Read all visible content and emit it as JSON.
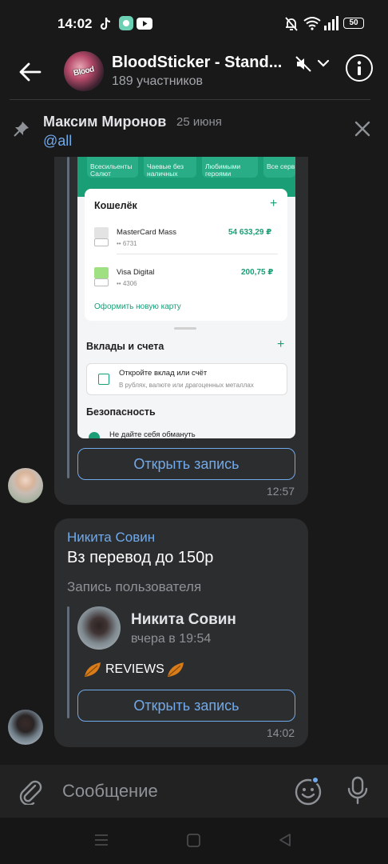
{
  "status_bar": {
    "time": "14:02",
    "battery": "50"
  },
  "header": {
    "avatar_text": "Blood",
    "title": "BloodSticker - Stand...",
    "subtitle": "189 участников"
  },
  "pinned": {
    "author": "Максим Миронов",
    "date": "25 июня",
    "text": "@all"
  },
  "screenshot": {
    "tiles": [
      "Всесильенты Салют",
      "Чаевые без наличных",
      "Любимыми героями",
      "Все серв"
    ],
    "wallet_title": "Кошелёк",
    "card1_name": "MasterCard Mass",
    "card1_num": "•• 6731",
    "card1_amount": "54 633,29 ₽",
    "card2_name": "Visa Digital",
    "card2_num": "•• 4306",
    "card2_amount": "200,75 ₽",
    "new_card": "Оформить новую карту",
    "deposits_title": "Вклады и счета",
    "deposit_text": "Откройте вклад или счёт",
    "deposit_sub": "В рублях, валюте или драгоценных металлах",
    "security_title": "Безопасность",
    "security_text": "Не дайте себя обмануть"
  },
  "messages": [
    {
      "button": "Открыть запись",
      "time": "12:57"
    },
    {
      "sender": "Никита Совин",
      "text": "Вз перевод до 150р",
      "repost_label": "Запись пользователя",
      "repost_author": "Никита Совин",
      "repost_date": "вчера в 19:54",
      "repost_text": "REVIEWS",
      "button": "Открыть запись",
      "time": "14:02"
    }
  ],
  "composer": {
    "placeholder": "Сообщение"
  },
  "colors": {
    "accent": "#71aaeb",
    "bubble": "#2c2d2e",
    "background": "#19191a",
    "bank_green": "#1a9e76"
  },
  "icons": [
    "tiktok-icon",
    "app-icon",
    "youtube-icon",
    "bell-off-icon",
    "wifi-icon",
    "signal-icon",
    "back-arrow-icon",
    "mute-icon",
    "chevron-down-icon",
    "info-icon",
    "pin-icon",
    "close-icon",
    "attach-icon",
    "emoji-icon",
    "mic-icon",
    "menu-icon",
    "home-icon",
    "back-icon"
  ]
}
